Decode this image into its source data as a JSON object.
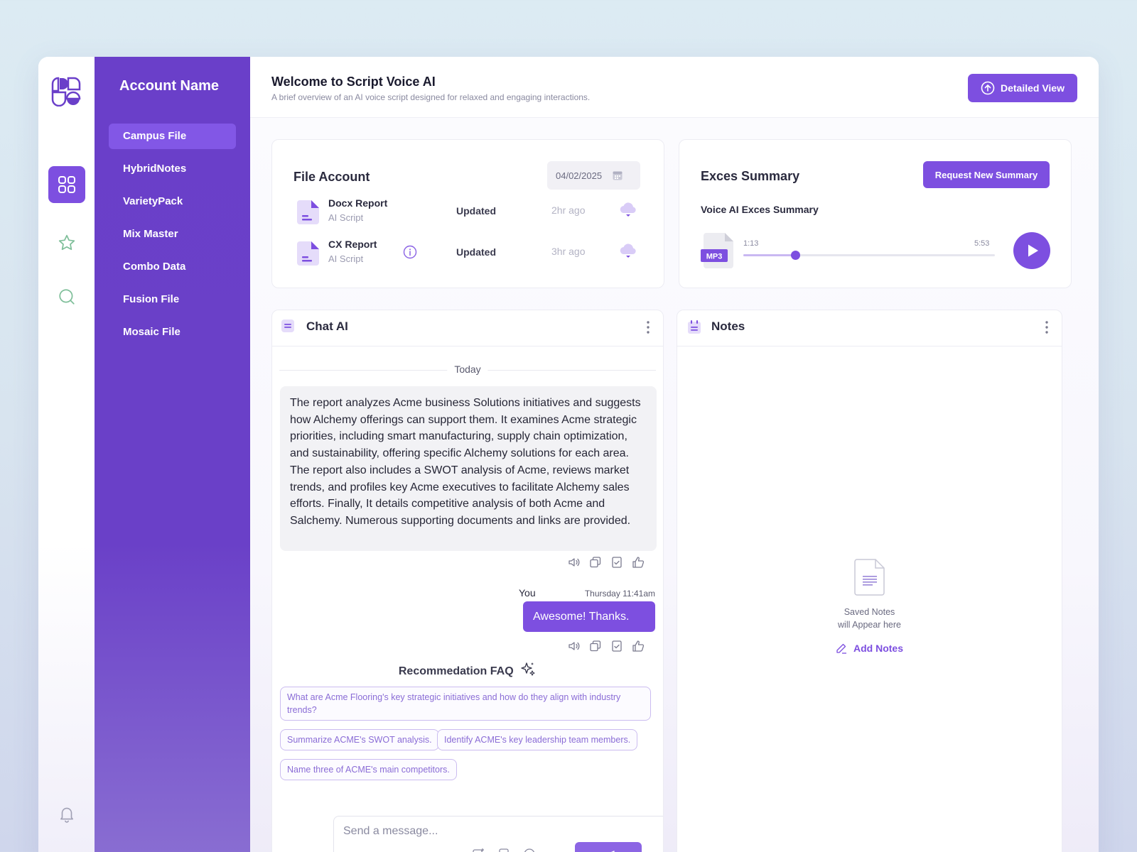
{
  "sidebar": {
    "account_name": "Account Name",
    "items": [
      {
        "label": "Campus File"
      },
      {
        "label": "HybridNotes"
      },
      {
        "label": "VarietyPack"
      },
      {
        "label": "Mix Master"
      },
      {
        "label": "Combo Data"
      },
      {
        "label": "Fusion File"
      },
      {
        "label": "Mosaic File"
      }
    ]
  },
  "rail": {
    "icons": [
      "grid-icon",
      "star-icon",
      "search-icon",
      "bell-icon"
    ]
  },
  "header": {
    "title": "Welcome to Script Voice AI",
    "subtitle": "A brief overview of an AI voice script designed for relaxed and engaging interactions.",
    "detail_button": "Detailed View"
  },
  "file_account": {
    "title": "File Account",
    "date": "04/02/2025",
    "files": [
      {
        "name": "Docx Report",
        "type": "AI Script",
        "status": "Updated",
        "time": "2hr ago"
      },
      {
        "name": "CX Report",
        "type": "AI Script",
        "status": "Updated",
        "time": "3hr ago"
      }
    ]
  },
  "summary": {
    "title": "Exces Summary",
    "request_button": "Request New Summary",
    "label": "Voice AI Exces Summary",
    "file_badge": "MP3",
    "current_time": "1:13",
    "duration": "5:53",
    "progress": 0.205
  },
  "chat": {
    "title": "Chat AI",
    "day": "Today",
    "ai_message": "The report analyzes Acme business Solutions initiatives and suggests how Alchemy offerings can support them. It examines Acme strategic priorities, including smart manufacturing, supply chain optimization, and sustainability, offering specific Alchemy solutions for each area. The report also includes a SWOT analysis of Acme, reviews market trends, and profiles key Acme executives to facilitate Alchemy sales efforts. Finally, It details competitive analysis of both Acme and Salchemy. Numerous supporting documents and links are provided.",
    "user_name": "You",
    "user_time": "Thursday 11:41am",
    "user_message": "Awesome! Thanks.",
    "faq_title": "Recommedation FAQ",
    "faq": [
      "What are Acme Flooring's key strategic initiatives and how do they align with industry trends?",
      "Summarize ACME's SWOT analysis.",
      "Identify ACME's key leadership team members.",
      "Name three of ACME's main competitors."
    ],
    "composer_placeholder": "Send a message..."
  },
  "notes": {
    "title": "Notes",
    "empty_text": "Saved Notes\nwill Appear here",
    "add_label": "Add Notes"
  },
  "colors": {
    "accent": "#7d4fe0",
    "sidebar": "#6a3fc9",
    "chip_border": "#cbbcf0"
  }
}
